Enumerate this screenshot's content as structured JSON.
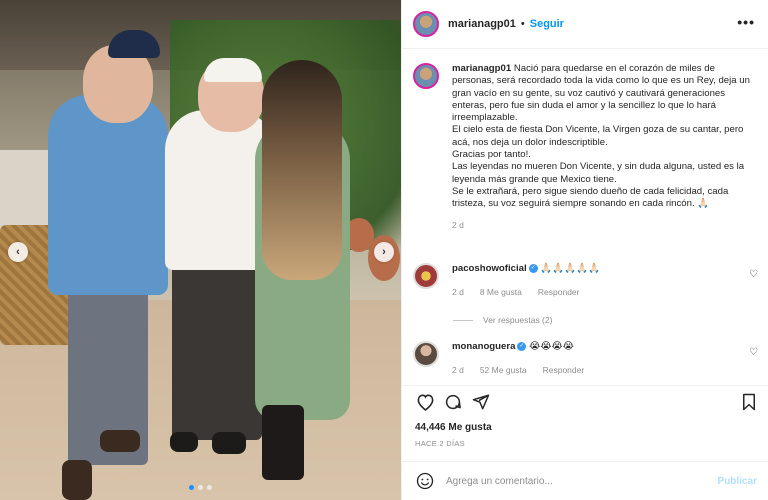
{
  "post": {
    "username": "marianagp01",
    "follow_label": "Seguir",
    "separator": "•",
    "more_icon": "more-options-icon"
  },
  "caption": {
    "username": "marianagp01",
    "lines": [
      "Nació para quedarse en el corazón de miles de personas, será recordado toda la vida como lo que es un Rey, deja un gran vacío en su gente, su voz cautivó y cautivará generaciones enteras, pero fue sin duda el amor y la sencillez lo que lo hará irreemplazable.",
      "El cielo esta de fiesta Don Vicente, la Virgen goza de su cantar, pero acá, nos deja un dolor indescriptible.",
      "Gracias por tanto!.",
      "Las leyendas no mueren Don Vicente, y sin duda alguna, usted es la leyenda más grande que Mexico tiene.",
      "Se le extrañará, pero sigue siendo dueño de cada felicidad, cada tristeza, su voz seguirá siempre sonando en cada rincón. 🙏🏻"
    ],
    "time": "2 d"
  },
  "comments": [
    {
      "username": "pacoshowoficial",
      "text": "🙏🏻🙏🏻🙏🏻🙏🏻🙏🏻",
      "time": "2 d",
      "likes": "8 Me gusta",
      "reply": "Responder"
    },
    {
      "username": "monanoguera",
      "text": "😭😭😭😭",
      "time": "2 d",
      "likes": "52 Me gusta",
      "reply": "Responder"
    }
  ],
  "view_replies": "Ver respuestas (2)",
  "actions": {
    "likes": "44,446 Me gusta",
    "posted": "HACE 2 DÍAS"
  },
  "add_comment": {
    "placeholder": "Agrega un comentario...",
    "publish": "Publicar"
  },
  "colors": {
    "accent": "#0095f6",
    "muted": "#8e8e8e",
    "publish_disabled": "#b2dffc"
  }
}
